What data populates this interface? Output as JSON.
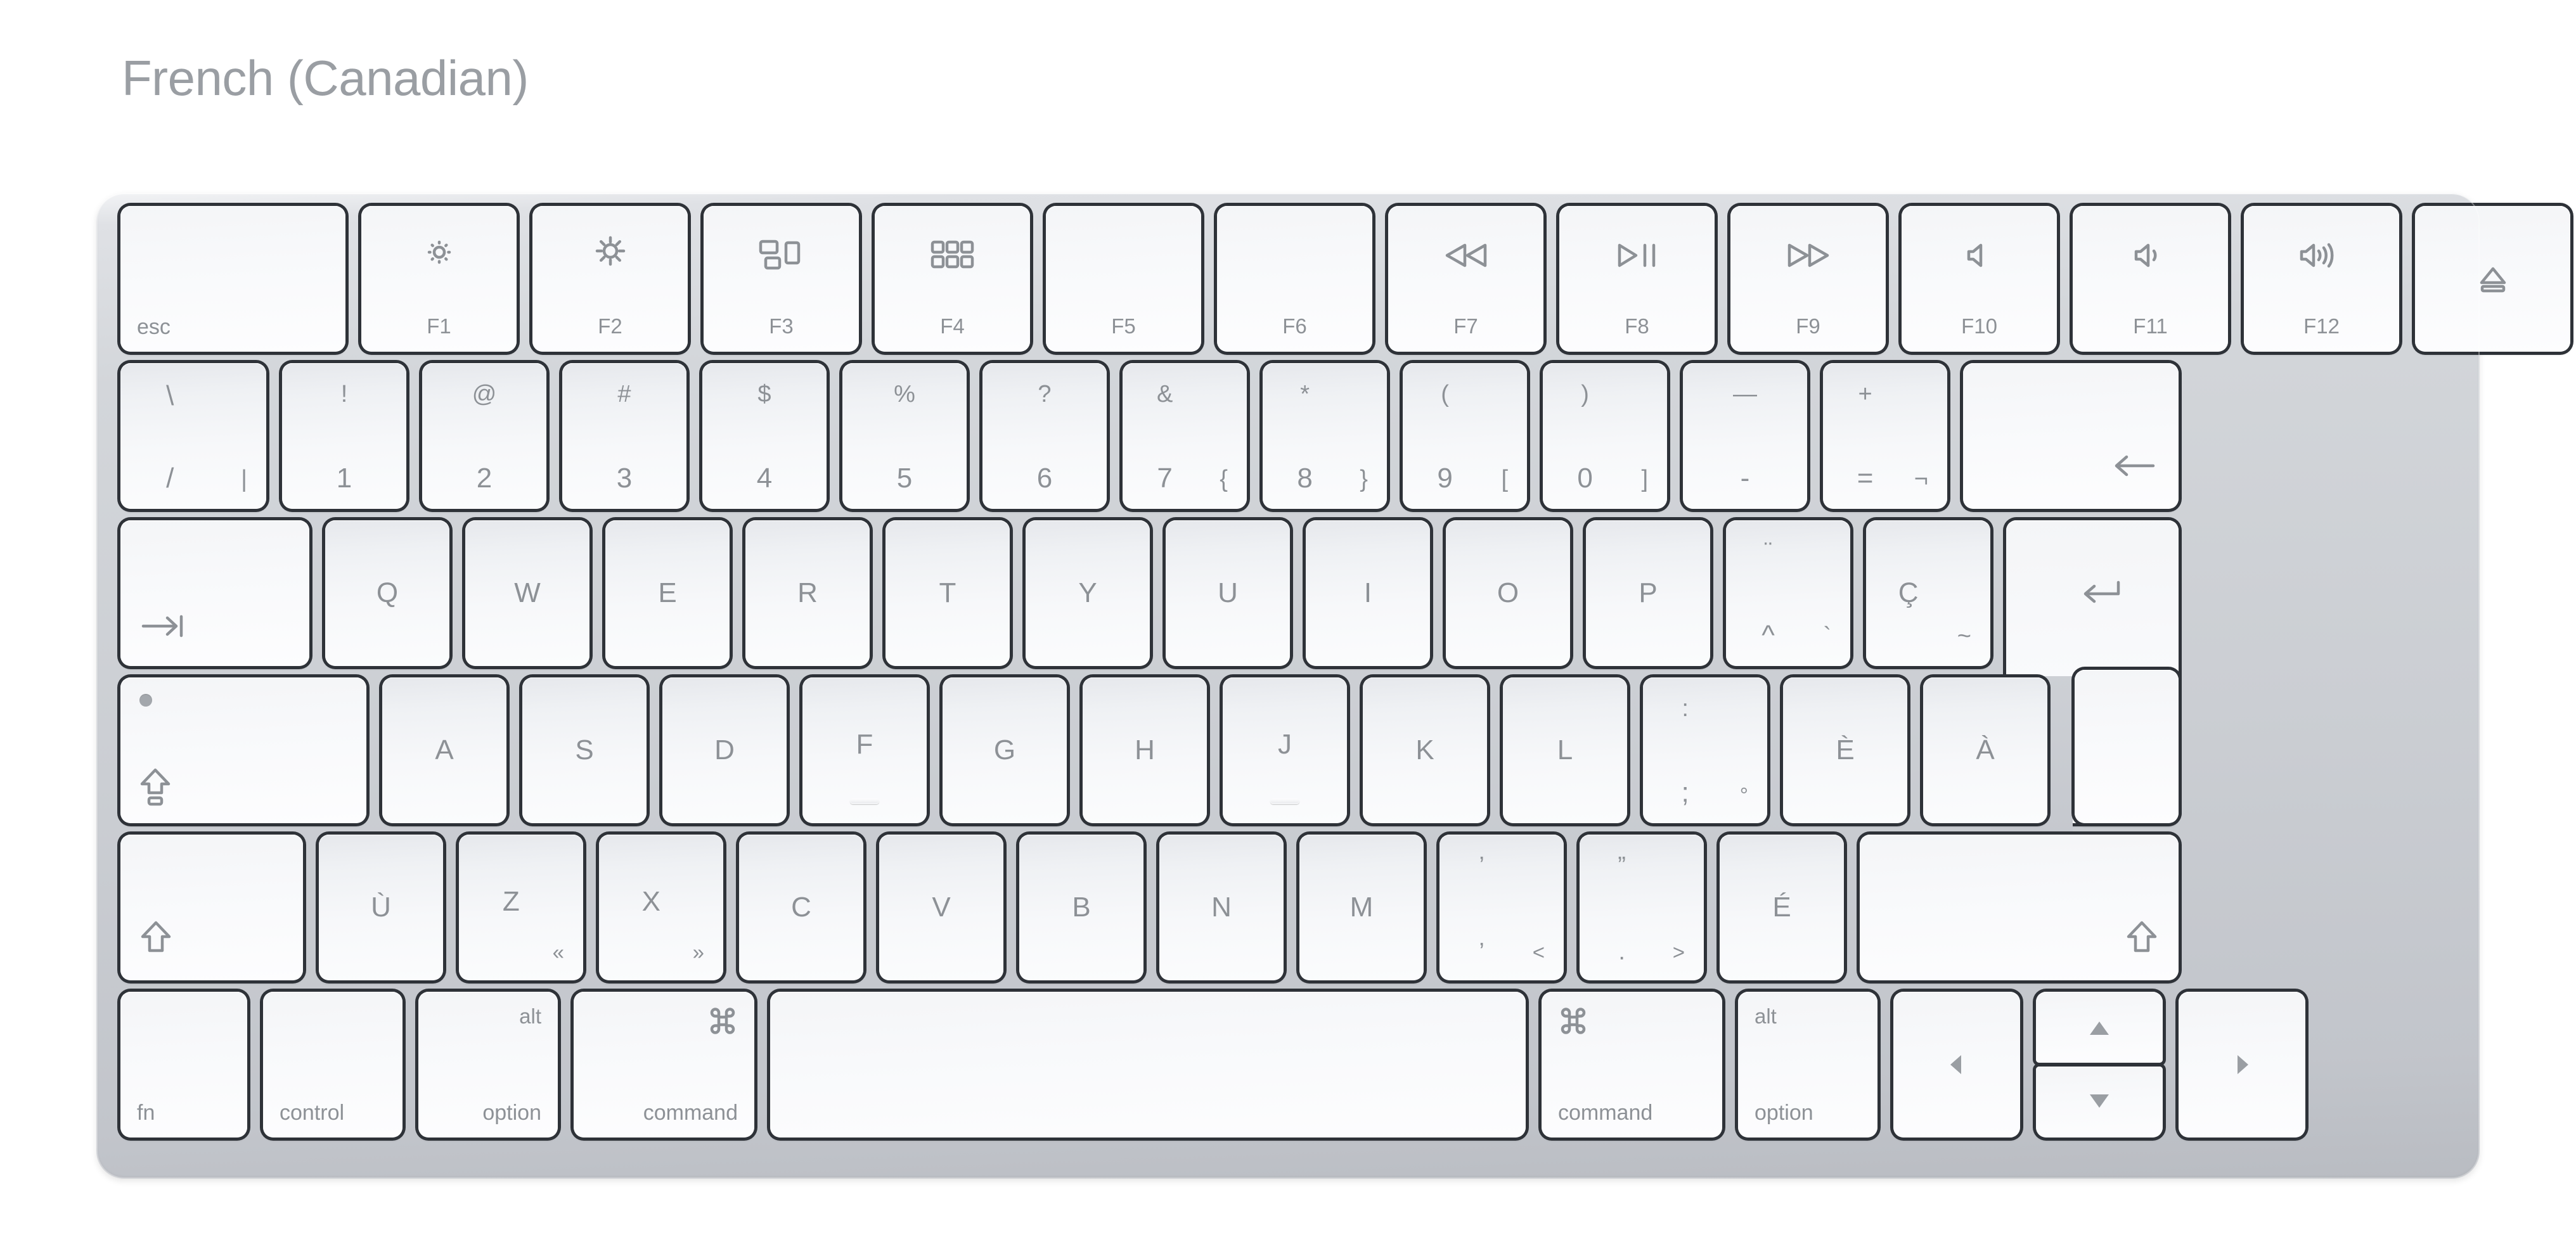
{
  "page": {
    "title": "French (Canadian)"
  },
  "colors": {
    "title_text": "#9a9ea3",
    "key_face": "#f7f8fa",
    "key_legend": "#8d9196",
    "key_border": "#2e3238",
    "chassis": "#cbced3"
  },
  "keyboard": {
    "name": "apple-magic-keyboard",
    "rows": [
      {
        "name": "function-row",
        "keys": [
          {
            "name": "esc",
            "legends": {
              "bottom_left": "esc"
            }
          },
          {
            "name": "f1",
            "icon": "brightness-down-icon",
            "legends": {
              "bottom_center": "F1"
            }
          },
          {
            "name": "f2",
            "icon": "brightness-up-icon",
            "legends": {
              "bottom_center": "F2"
            }
          },
          {
            "name": "f3",
            "icon": "mission-control-icon",
            "legends": {
              "bottom_center": "F3"
            }
          },
          {
            "name": "f4",
            "icon": "launchpad-icon",
            "legends": {
              "bottom_center": "F4"
            }
          },
          {
            "name": "f5",
            "icon": "",
            "legends": {
              "bottom_center": "F5"
            }
          },
          {
            "name": "f6",
            "icon": "",
            "legends": {
              "bottom_center": "F6"
            }
          },
          {
            "name": "f7",
            "icon": "rewind-icon",
            "legends": {
              "bottom_center": "F7"
            }
          },
          {
            "name": "f8",
            "icon": "play-pause-icon",
            "legends": {
              "bottom_center": "F8"
            }
          },
          {
            "name": "f9",
            "icon": "fast-forward-icon",
            "legends": {
              "bottom_center": "F9"
            }
          },
          {
            "name": "f10",
            "icon": "volume-mute-icon",
            "legends": {
              "bottom_center": "F10"
            }
          },
          {
            "name": "f11",
            "icon": "volume-down-icon",
            "legends": {
              "bottom_center": "F11"
            }
          },
          {
            "name": "f12",
            "icon": "volume-up-icon",
            "legends": {
              "bottom_center": "F12"
            }
          },
          {
            "name": "eject",
            "icon": "eject-icon",
            "legends": {}
          }
        ]
      },
      {
        "name": "number-row",
        "keys": [
          {
            "name": "backslash-slash-pipe",
            "legends": {
              "upper": "\\",
              "lower": "/",
              "bottom_right": "|"
            }
          },
          {
            "name": "digit-1",
            "legends": {
              "upper": "!",
              "lower": "1"
            }
          },
          {
            "name": "digit-2",
            "legends": {
              "upper": "@",
              "lower": "2"
            }
          },
          {
            "name": "digit-3",
            "legends": {
              "upper": "#",
              "lower": "3"
            }
          },
          {
            "name": "digit-4",
            "legends": {
              "upper": "$",
              "lower": "4"
            }
          },
          {
            "name": "digit-5",
            "legends": {
              "upper": "%",
              "lower": "5"
            }
          },
          {
            "name": "digit-6",
            "legends": {
              "upper": "?",
              "lower": "6"
            }
          },
          {
            "name": "digit-7",
            "legends": {
              "upper": "&",
              "lower": "7",
              "bottom_right": "{"
            }
          },
          {
            "name": "digit-8",
            "legends": {
              "upper": "*",
              "lower": "8",
              "bottom_right": "}"
            }
          },
          {
            "name": "digit-9",
            "legends": {
              "upper": "(",
              "lower": "9",
              "bottom_right": "["
            }
          },
          {
            "name": "digit-0",
            "legends": {
              "upper": ")",
              "lower": "0",
              "bottom_right": "]"
            }
          },
          {
            "name": "minus",
            "legends": {
              "upper": "—",
              "lower": "-"
            }
          },
          {
            "name": "equal",
            "legends": {
              "upper": "+",
              "lower": "=",
              "bottom_right": "¬"
            }
          },
          {
            "name": "delete",
            "icon": "delete-left-arrow-icon",
            "legends": {}
          }
        ]
      },
      {
        "name": "top-letter-row",
        "keys": [
          {
            "name": "tab",
            "icon": "tab-icon",
            "legends": {}
          },
          {
            "name": "letter-q",
            "legends": {
              "center": "Q"
            }
          },
          {
            "name": "letter-w",
            "legends": {
              "center": "W"
            }
          },
          {
            "name": "letter-e",
            "legends": {
              "center": "E"
            }
          },
          {
            "name": "letter-r",
            "legends": {
              "center": "R"
            }
          },
          {
            "name": "letter-t",
            "legends": {
              "center": "T"
            }
          },
          {
            "name": "letter-y",
            "legends": {
              "center": "Y"
            }
          },
          {
            "name": "letter-u",
            "legends": {
              "center": "U"
            }
          },
          {
            "name": "letter-i",
            "legends": {
              "center": "I"
            }
          },
          {
            "name": "letter-o",
            "legends": {
              "center": "O"
            }
          },
          {
            "name": "letter-p",
            "legends": {
              "center": "P"
            }
          },
          {
            "name": "diaeresis-circumflex-grave",
            "legends": {
              "upper": "¨",
              "lower": "^",
              "bottom_right": "`"
            }
          },
          {
            "name": "letter-c-cedilla",
            "legends": {
              "center": "Ç",
              "bottom_right": "~"
            }
          },
          {
            "name": "return",
            "icon": "return-icon",
            "legends": {
              "bottom_center": "⊼"
            }
          }
        ]
      },
      {
        "name": "home-row",
        "keys": [
          {
            "name": "caps-lock",
            "icon": "caps-lock-icon",
            "legends": {},
            "indicator": true
          },
          {
            "name": "letter-a",
            "legends": {
              "center": "A"
            }
          },
          {
            "name": "letter-s",
            "legends": {
              "center": "S"
            }
          },
          {
            "name": "letter-d",
            "legends": {
              "center": "D"
            }
          },
          {
            "name": "letter-f",
            "legends": {
              "center": "F"
            },
            "bump": true
          },
          {
            "name": "letter-g",
            "legends": {
              "center": "G"
            }
          },
          {
            "name": "letter-h",
            "legends": {
              "center": "H"
            }
          },
          {
            "name": "letter-j",
            "legends": {
              "center": "J"
            },
            "bump": true
          },
          {
            "name": "letter-k",
            "legends": {
              "center": "K"
            }
          },
          {
            "name": "letter-l",
            "legends": {
              "center": "L"
            }
          },
          {
            "name": "colon-semicolon-degree",
            "legends": {
              "upper": ":",
              "lower": ";",
              "bottom_right": "°"
            }
          },
          {
            "name": "letter-e-grave",
            "legends": {
              "center": "È"
            }
          },
          {
            "name": "letter-a-grave",
            "legends": {
              "center": "À"
            }
          }
        ]
      },
      {
        "name": "shift-row",
        "keys": [
          {
            "name": "left-shift",
            "icon": "shift-icon",
            "legends": {}
          },
          {
            "name": "letter-u-grave",
            "legends": {
              "center": "Ù"
            }
          },
          {
            "name": "letter-z",
            "legends": {
              "center": "Z",
              "bottom_right": "«"
            }
          },
          {
            "name": "letter-x",
            "legends": {
              "center": "X",
              "bottom_right": "»"
            }
          },
          {
            "name": "letter-c",
            "legends": {
              "center": "C"
            }
          },
          {
            "name": "letter-v",
            "legends": {
              "center": "V"
            }
          },
          {
            "name": "letter-b",
            "legends": {
              "center": "B"
            }
          },
          {
            "name": "letter-n",
            "legends": {
              "center": "N"
            }
          },
          {
            "name": "letter-m",
            "legends": {
              "center": "M"
            }
          },
          {
            "name": "comma-apostrophe-less",
            "legends": {
              "upper": "’",
              "lower": "’",
              "bottom_right": "<"
            }
          },
          {
            "name": "period-quote-greater",
            "legends": {
              "upper": "”",
              "lower": ".",
              "bottom_right": ">"
            }
          },
          {
            "name": "letter-e-acute",
            "legends": {
              "center": "É"
            }
          },
          {
            "name": "right-shift",
            "icon": "shift-icon",
            "legends": {}
          }
        ]
      },
      {
        "name": "modifier-row",
        "keys": [
          {
            "name": "fn",
            "legends": {
              "bottom_left": "fn"
            }
          },
          {
            "name": "left-control",
            "legends": {
              "bottom_left": "control"
            }
          },
          {
            "name": "left-option",
            "legends": {
              "top_right": "alt",
              "bottom_right": "option"
            }
          },
          {
            "name": "left-command",
            "icon": "command-icon",
            "legends": {
              "bottom_right": "command"
            }
          },
          {
            "name": "space",
            "legends": {}
          },
          {
            "name": "right-command",
            "icon": "command-icon",
            "legends": {
              "bottom_left": "command"
            }
          },
          {
            "name": "right-option",
            "legends": {
              "top_left": "alt",
              "bottom_left": "option"
            }
          },
          {
            "name": "arrow-left",
            "icon": "arrow-left-icon",
            "legends": {}
          },
          {
            "name": "arrow-up",
            "icon": "arrow-up-icon",
            "legends": {}
          },
          {
            "name": "arrow-down",
            "icon": "arrow-down-icon",
            "legends": {}
          },
          {
            "name": "arrow-right",
            "icon": "arrow-right-icon",
            "legends": {}
          }
        ]
      }
    ]
  }
}
